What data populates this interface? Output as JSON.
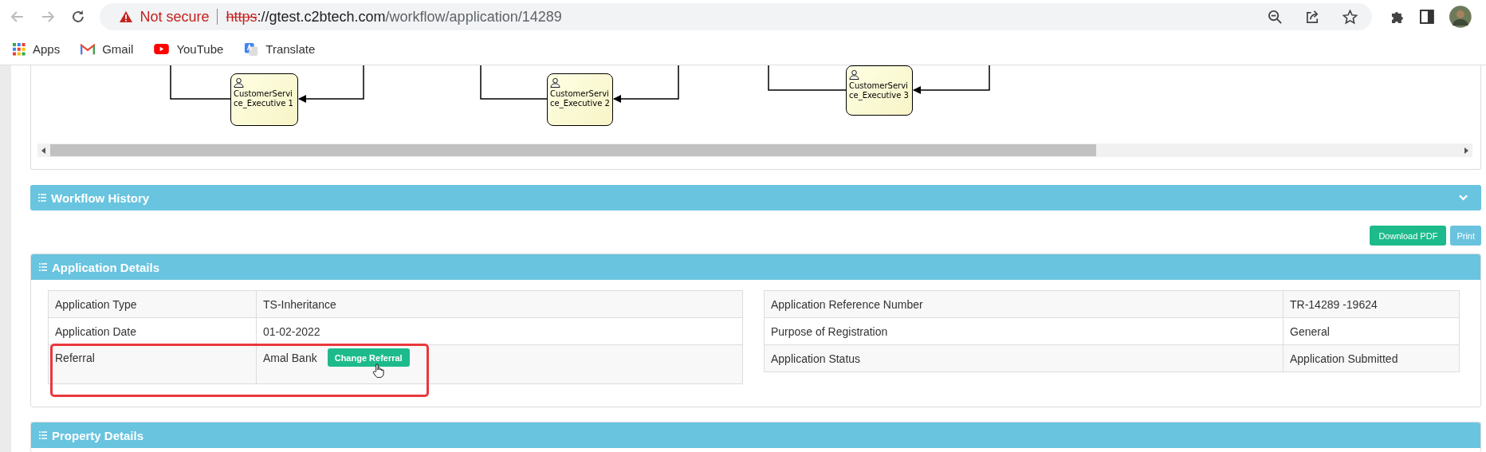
{
  "browser": {
    "security": "Not secure",
    "url_scheme": "https",
    "url_host": "://gtest.c2btech.com",
    "url_path": "/workflow/application/14289",
    "bookmarks": [
      {
        "kind": "apps",
        "label": "Apps"
      },
      {
        "kind": "gmail",
        "label": "Gmail"
      },
      {
        "kind": "youtube",
        "label": "YouTube"
      },
      {
        "kind": "translate",
        "label": "Translate"
      }
    ]
  },
  "diagram": {
    "nodes": [
      {
        "lines": [
          "CustomerServi",
          "ce_Executive 1"
        ]
      },
      {
        "lines": [
          "CustomerServi",
          "ce_Executive 2"
        ]
      },
      {
        "lines": [
          "CustomerServi",
          "ce_Executive 3"
        ]
      }
    ]
  },
  "workflow_history": {
    "title": "Workflow History",
    "expanded": false
  },
  "actions": [
    "Download PDF",
    "Print"
  ],
  "application_details": {
    "title": "Application Details",
    "left_rows": [
      {
        "label": "Application Type",
        "value": "TS-Inheritance"
      },
      {
        "label": "Application Date",
        "value": "01-02-2022"
      },
      {
        "label": "Referral",
        "value": "Amal Bank",
        "action": "Change Referral",
        "highlighted": true
      }
    ],
    "right_rows": [
      {
        "label": "Application Reference Number",
        "value": "TR-14289 -19624"
      },
      {
        "label": "Purpose of Registration",
        "value": "General"
      },
      {
        "label": "Application Status",
        "value": "Application Submitted"
      }
    ]
  },
  "property_details": {
    "title": "Property Details"
  }
}
